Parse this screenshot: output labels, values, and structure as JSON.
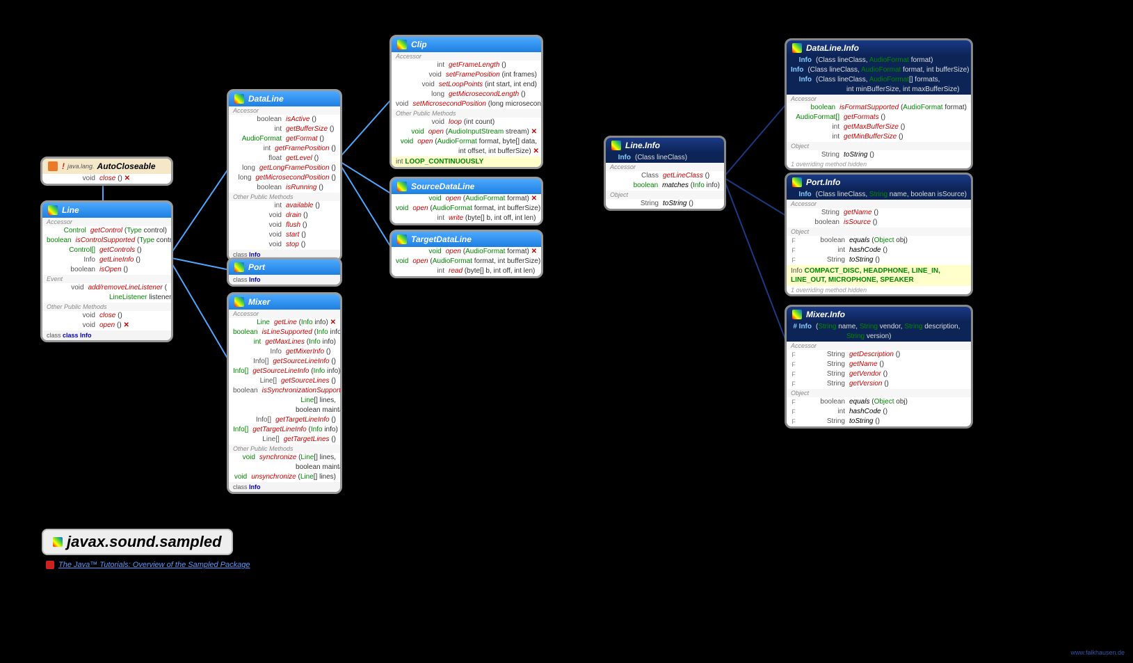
{
  "package": "javax.sound.sampled",
  "tutorial_link": "The Java™ Tutorials: Overview of the Sampled Package",
  "attribution": "www.falkhausen.de",
  "boxes": {
    "autocloseable": {
      "pkg": "java.lang.",
      "name": "AutoCloseable",
      "rows": [
        {
          "rtype": "void",
          "m": "close",
          "args": "()",
          "x": true
        }
      ]
    },
    "line": {
      "name": "Line",
      "sections": [
        {
          "label": "Accessor",
          "rows": [
            {
              "rtype": "Control",
              "m": "getControl",
              "args": "(Type control)",
              "rg": true
            },
            {
              "rtype": "boolean",
              "m": "isControlSupported",
              "args": "(Type control)",
              "rg": true
            },
            {
              "rtype": "Control[]",
              "m": "getControls",
              "args": "()",
              "rg": true
            },
            {
              "rtype": "Info",
              "m": "getLineInfo",
              "args": "()"
            },
            {
              "rtype": "boolean",
              "m": "isOpen",
              "args": "()"
            }
          ]
        },
        {
          "label": "Event",
          "rows": [
            {
              "rtype": "void",
              "m": "add/removeLineListener",
              "args": "("
            },
            {
              "rtype": "",
              "m": "",
              "args": "LineListener listener)",
              "ind": true,
              "rg": true
            }
          ]
        },
        {
          "label": "Other Public Methods",
          "rows": [
            {
              "rtype": "void",
              "m": "close",
              "args": "()"
            },
            {
              "rtype": "void",
              "m": "open",
              "args": "()",
              "x": true
            }
          ]
        }
      ],
      "bottom": "class Info"
    },
    "dataline": {
      "name": "DataLine",
      "sections": [
        {
          "label": "Accessor",
          "rows": [
            {
              "rtype": "boolean",
              "m": "isActive",
              "args": "()"
            },
            {
              "rtype": "int",
              "m": "getBufferSize",
              "args": "()"
            },
            {
              "rtype": "AudioFormat",
              "m": "getFormat",
              "args": "()",
              "rg": true
            },
            {
              "rtype": "int",
              "m": "getFramePosition",
              "args": "()"
            },
            {
              "rtype": "float",
              "m": "getLevel",
              "args": "()"
            },
            {
              "rtype": "long",
              "m": "getLongFramePosition",
              "args": "()"
            },
            {
              "rtype": "long",
              "m": "getMicrosecondPosition",
              "args": "()"
            },
            {
              "rtype": "boolean",
              "m": "isRunning",
              "args": "()"
            }
          ]
        },
        {
          "label": "Other Public Methods",
          "rows": [
            {
              "rtype": "int",
              "m": "available",
              "args": "()"
            },
            {
              "rtype": "void",
              "m": "drain",
              "args": "()"
            },
            {
              "rtype": "void",
              "m": "flush",
              "args": "()"
            },
            {
              "rtype": "void",
              "m": "start",
              "args": "()"
            },
            {
              "rtype": "void",
              "m": "stop",
              "args": "()"
            }
          ]
        }
      ],
      "bottom": "class Info"
    },
    "port": {
      "name": "Port",
      "bottom": "class Info"
    },
    "mixer": {
      "name": "Mixer",
      "sections": [
        {
          "label": "Accessor",
          "rows": [
            {
              "rtype": "Line",
              "m": "getLine",
              "args": "(Info info)",
              "rg": true,
              "x": true
            },
            {
              "rtype": "boolean",
              "m": "isLineSupported",
              "args": "(Info info)",
              "rg": true
            },
            {
              "rtype": "int",
              "m": "getMaxLines",
              "args": "(Info info)",
              "rg": true
            },
            {
              "rtype": "Info",
              "m": "getMixerInfo",
              "args": "()"
            },
            {
              "rtype": "Info[]",
              "m": "getSourceLineInfo",
              "args": "()"
            },
            {
              "rtype": "Info[]",
              "m": "getSourceLineInfo",
              "args": "(Info info)",
              "rg": true
            },
            {
              "rtype": "Line[]",
              "m": "getSourceLines",
              "args": "()"
            },
            {
              "rtype": "boolean",
              "m": "isSynchronizationSupported",
              "args": "("
            },
            {
              "rtype": "",
              "m": "",
              "args": "Line[] lines,",
              "ind": true,
              "rg": true
            },
            {
              "rtype": "",
              "m": "",
              "args": "boolean maintainSync)",
              "ind": true
            },
            {
              "rtype": "Info[]",
              "m": "getTargetLineInfo",
              "args": "()"
            },
            {
              "rtype": "Info[]",
              "m": "getTargetLineInfo",
              "args": "(Info info)",
              "rg": true
            },
            {
              "rtype": "Line[]",
              "m": "getTargetLines",
              "args": "()"
            }
          ]
        },
        {
          "label": "Other Public Methods",
          "rows": [
            {
              "rtype": "void",
              "m": "synchronize",
              "args": "(Line[] lines,",
              "rg": true
            },
            {
              "rtype": "",
              "m": "",
              "args": "boolean maintainSync)",
              "ind": true
            },
            {
              "rtype": "void",
              "m": "unsynchronize",
              "args": "(Line[] lines)",
              "rg": true
            }
          ]
        }
      ],
      "bottom": "class Info"
    },
    "clip": {
      "name": "Clip",
      "sections": [
        {
          "label": "Accessor",
          "rows": [
            {
              "rtype": "int",
              "m": "getFrameLength",
              "args": "()"
            },
            {
              "rtype": "void",
              "m": "setFramePosition",
              "args": "(int frames)"
            },
            {
              "rtype": "void",
              "m": "setLoopPoints",
              "args": "(int start, int end)"
            },
            {
              "rtype": "long",
              "m": "getMicrosecondLength",
              "args": "()"
            },
            {
              "rtype": "void",
              "m": "setMicrosecondPosition",
              "args": "(long microseconds)"
            }
          ]
        },
        {
          "label": "Other Public Methods",
          "rows": [
            {
              "rtype": "void",
              "m": "loop",
              "args": "(int count)"
            },
            {
              "rtype": "void",
              "m": "open",
              "args": "(AudioInputStream stream)",
              "rg": true,
              "x": true
            },
            {
              "rtype": "void",
              "m": "open",
              "args": "(AudioFormat format, byte[] data,",
              "rg": true
            },
            {
              "rtype": "",
              "m": "",
              "args": "int offset, int bufferSize)",
              "ind": true,
              "x": true
            }
          ]
        }
      ],
      "const": "int LOOP_CONTINUOUSLY"
    },
    "srcdl": {
      "name": "SourceDataLine",
      "rows": [
        {
          "rtype": "void",
          "m": "open",
          "args": "(AudioFormat format)",
          "rg": true,
          "x": true
        },
        {
          "rtype": "void",
          "m": "open",
          "args": "(AudioFormat format, int bufferSize)",
          "rg": true,
          "x": true
        },
        {
          "rtype": "int",
          "m": "write",
          "args": "(byte[] b, int off, int len)"
        }
      ]
    },
    "tgtdl": {
      "name": "TargetDataLine",
      "rows": [
        {
          "rtype": "void",
          "m": "open",
          "args": "(AudioFormat format)",
          "rg": true,
          "x": true
        },
        {
          "rtype": "void",
          "m": "open",
          "args": "(AudioFormat format, int bufferSize)",
          "rg": true,
          "x": true
        },
        {
          "rtype": "int",
          "m": "read",
          "args": "(byte[] b, int off, int len)"
        }
      ]
    },
    "lineinfo": {
      "name": "Line.Info",
      "ctor": [
        {
          "rtype": "Info",
          "args": "(Class<?> lineClass)"
        }
      ],
      "sections": [
        {
          "label": "Accessor",
          "rows": [
            {
              "rtype": "Class<?>",
              "m": "getLineClass",
              "args": "()"
            },
            {
              "rtype": "boolean",
              "m": "matches",
              "args": "(Info info)",
              "blk": true,
              "rg": true
            }
          ]
        },
        {
          "label": "Object",
          "rows": [
            {
              "rtype": "String",
              "m": "toString",
              "args": "()",
              "blk": true
            }
          ]
        }
      ]
    },
    "dlinfo": {
      "name": "DataLine.Info",
      "ctor": [
        {
          "rtype": "Info",
          "args": "(Class<?> lineClass, AudioFormat format)"
        },
        {
          "rtype": "Info",
          "args": "(Class<?> lineClass, AudioFormat format, int bufferSize)"
        },
        {
          "rtype": "Info",
          "args": "(Class<?> lineClass, AudioFormat[] formats,"
        },
        {
          "rtype": "",
          "args": "int minBufferSize, int maxBufferSize)",
          "ind": true
        }
      ],
      "sections": [
        {
          "label": "Accessor",
          "rows": [
            {
              "rtype": "boolean",
              "m": "isFormatSupported",
              "args": "(AudioFormat format)",
              "rg": true
            },
            {
              "rtype": "AudioFormat[]",
              "m": "getFormats",
              "args": "()",
              "rg": true
            },
            {
              "rtype": "int",
              "m": "getMaxBufferSize",
              "args": "()"
            },
            {
              "rtype": "int",
              "m": "getMinBufferSize",
              "args": "()"
            }
          ]
        },
        {
          "label": "Object",
          "rows": [
            {
              "rtype": "String",
              "m": "toString",
              "args": "()",
              "blk": true
            }
          ]
        }
      ],
      "hid": "1 overriding method hidden"
    },
    "portinfo": {
      "name": "Port.Info",
      "ctor": [
        {
          "rtype": "Info",
          "args": "(Class<?> lineClass, String name, boolean isSource)"
        }
      ],
      "sections": [
        {
          "label": "Accessor",
          "rows": [
            {
              "rtype": "String",
              "m": "getName",
              "args": "()"
            },
            {
              "rtype": "boolean",
              "m": "isSource",
              "args": "()"
            }
          ]
        },
        {
          "label": "Object",
          "rows": [
            {
              "rtype": "boolean",
              "m": "equals",
              "args": "(Object obj)",
              "blk": true,
              "f": "F"
            },
            {
              "rtype": "int",
              "m": "hashCode",
              "args": "()",
              "blk": true,
              "f": "F"
            },
            {
              "rtype": "String",
              "m": "toString",
              "args": "()",
              "blk": true,
              "f": "F"
            }
          ]
        }
      ],
      "const": "Info COMPACT_DISC, HEADPHONE, LINE_IN, LINE_OUT, MICROPHONE, SPEAKER",
      "hid": "1 overriding method hidden"
    },
    "mixerinfo": {
      "name": "Mixer.Info",
      "ctor": [
        {
          "rtype": "# Info",
          "args": "(String name, String vendor, String description,"
        },
        {
          "rtype": "",
          "args": "String version)",
          "ind": true
        }
      ],
      "sections": [
        {
          "label": "Accessor",
          "rows": [
            {
              "rtype": "String",
              "m": "getDescription",
              "args": "()",
              "f": "F"
            },
            {
              "rtype": "String",
              "m": "getName",
              "args": "()",
              "f": "F"
            },
            {
              "rtype": "String",
              "m": "getVendor",
              "args": "()",
              "f": "F"
            },
            {
              "rtype": "String",
              "m": "getVersion",
              "args": "()",
              "f": "F"
            }
          ]
        },
        {
          "label": "Object",
          "rows": [
            {
              "rtype": "boolean",
              "m": "equals",
              "args": "(Object obj)",
              "blk": true,
              "f": "F"
            },
            {
              "rtype": "int",
              "m": "hashCode",
              "args": "()",
              "blk": true,
              "f": "F"
            },
            {
              "rtype": "String",
              "m": "toString",
              "args": "()",
              "blk": true,
              "f": "F"
            }
          ]
        }
      ]
    }
  }
}
